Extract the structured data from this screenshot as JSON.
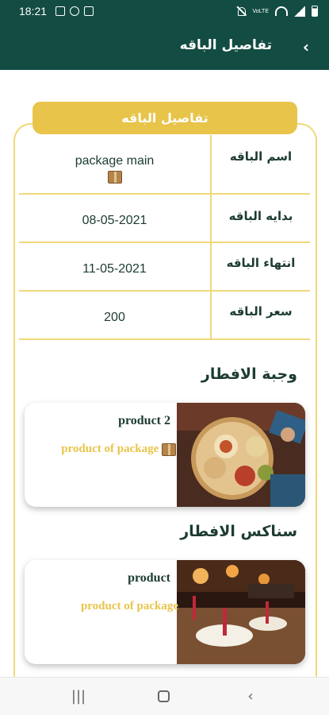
{
  "status_bar": {
    "time": "18:21",
    "icons": [
      "image-icon",
      "instagram-icon",
      "message-icon",
      "mute-icon",
      "wifi-icon",
      "signal-icon",
      "battery-icon"
    ],
    "network": "VoLTE"
  },
  "app_bar": {
    "title": "تفاصيل الباقه",
    "back_icon": "chevron-left-icon"
  },
  "details": {
    "tab_title": "تفاصيل الباقه",
    "rows": [
      {
        "label": "اسم الباقه",
        "value": "package main"
      },
      {
        "label": "بدايه الباقه",
        "value": "08-05-2021"
      },
      {
        "label": "انتهاء الباقه",
        "value": "11-05-2021"
      },
      {
        "label": "سعر الباقه",
        "value": "200"
      }
    ]
  },
  "sections": [
    {
      "title": "وجبة الافطار",
      "product": {
        "name": "product 2",
        "description": "product of package",
        "image": "breakfast-food-photo"
      }
    },
    {
      "title": "سناكس الافطار",
      "product": {
        "name": "product",
        "description": "product of package",
        "image": "restaurant-interior-photo"
      }
    }
  ],
  "nav_bar": {
    "buttons": [
      "recents-icon",
      "home-icon",
      "back-icon"
    ]
  },
  "colors": {
    "primary": "#134c42",
    "accent": "#e8c44a",
    "border": "#f0d97a"
  }
}
